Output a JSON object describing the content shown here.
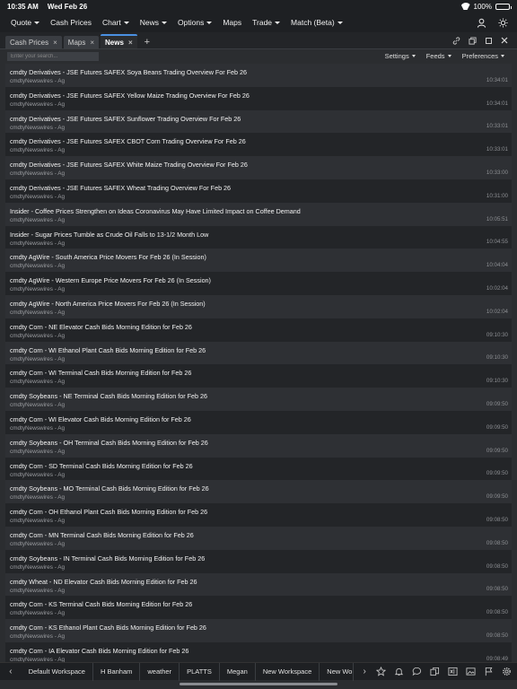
{
  "status": {
    "time": "10:35 AM",
    "date": "Wed Feb 26",
    "battery": "100%"
  },
  "menu": {
    "items": [
      {
        "label": "Quote",
        "caret": true
      },
      {
        "label": "Cash Prices",
        "caret": false
      },
      {
        "label": "Chart",
        "caret": true
      },
      {
        "label": "News",
        "caret": true
      },
      {
        "label": "Options",
        "caret": true
      },
      {
        "label": "Maps",
        "caret": false
      },
      {
        "label": "Trade",
        "caret": true
      },
      {
        "label": "Match (Beta)",
        "caret": true
      }
    ]
  },
  "tabs": [
    {
      "label": "Cash Prices",
      "active": false
    },
    {
      "label": "Maps",
      "active": false
    },
    {
      "label": "News",
      "active": true
    }
  ],
  "tab_add": "+",
  "tab_close": "×",
  "toolbar": {
    "search_placeholder": "Enter your search...",
    "settings": "Settings",
    "feeds": "Feeds",
    "preferences": "Preferences"
  },
  "news": [
    {
      "title": "cmdty Derivatives - JSE Futures SAFEX Soya Beans Trading Overview For Feb 26",
      "source": "cmdtyNewswires - Ag",
      "time": "10:34:01"
    },
    {
      "title": "cmdty Derivatives - JSE Futures SAFEX Yellow Maize Trading Overview For Feb 26",
      "source": "cmdtyNewswires - Ag",
      "time": "10:34:01"
    },
    {
      "title": "cmdty Derivatives - JSE Futures SAFEX Sunflower Trading Overview For Feb 26",
      "source": "cmdtyNewswires - Ag",
      "time": "10:33:01"
    },
    {
      "title": "cmdty Derivatives - JSE Futures SAFEX CBOT Corn Trading Overview For Feb 26",
      "source": "cmdtyNewswires - Ag",
      "time": "10:33:01"
    },
    {
      "title": "cmdty Derivatives - JSE Futures SAFEX White Maize Trading Overview For Feb 26",
      "source": "cmdtyNewswires - Ag",
      "time": "10:33:00"
    },
    {
      "title": "cmdty Derivatives - JSE Futures SAFEX Wheat Trading Overview For Feb 26",
      "source": "cmdtyNewswires - Ag",
      "time": "10:31:00"
    },
    {
      "title": "Insider - Coffee Prices Strengthen on Ideas Coronavirus May Have Limited Impact on Coffee Demand",
      "source": "cmdtyNewswires - Ag",
      "time": "10:05:51"
    },
    {
      "title": "Insider - Sugar Prices Tumble as Crude Oil Falls to 13-1/2 Month Low",
      "source": "cmdtyNewswires - Ag",
      "time": "10:04:55"
    },
    {
      "title": "cmdty AgWire - South America Price Movers For Feb 26 (In Session)",
      "source": "cmdtyNewswires - Ag",
      "time": "10:04:04"
    },
    {
      "title": "cmdty AgWire - Western Europe Price Movers For Feb 26 (In Session)",
      "source": "cmdtyNewswires - Ag",
      "time": "10:02:04"
    },
    {
      "title": "cmdty AgWire - North America Price Movers For Feb 26 (In Session)",
      "source": "cmdtyNewswires - Ag",
      "time": "10:02:04"
    },
    {
      "title": "cmdty Corn - NE Elevator Cash Bids Morning Edition for Feb 26",
      "source": "cmdtyNewswires - Ag",
      "time": "09:10:30"
    },
    {
      "title": "cmdty Corn - WI Ethanol Plant Cash Bids Morning Edition for Feb 26",
      "source": "cmdtyNewswires - Ag",
      "time": "09:10:30"
    },
    {
      "title": "cmdty Corn - WI Terminal Cash Bids Morning Edition for Feb 26",
      "source": "cmdtyNewswires - Ag",
      "time": "09:10:30"
    },
    {
      "title": "cmdty Soybeans - NE Terminal Cash Bids Morning Edition for Feb 26",
      "source": "cmdtyNewswires - Ag",
      "time": "09:09:50"
    },
    {
      "title": "cmdty Corn - WI Elevator Cash Bids Morning Edition for Feb 26",
      "source": "cmdtyNewswires - Ag",
      "time": "09:09:50"
    },
    {
      "title": "cmdty Soybeans - OH Terminal Cash Bids Morning Edition for Feb 26",
      "source": "cmdtyNewswires - Ag",
      "time": "09:09:50"
    },
    {
      "title": "cmdty Corn - SD Terminal Cash Bids Morning Edition for Feb 26",
      "source": "cmdtyNewswires - Ag",
      "time": "09:09:50"
    },
    {
      "title": "cmdty Soybeans - MO Terminal Cash Bids Morning Edition for Feb 26",
      "source": "cmdtyNewswires - Ag",
      "time": "09:09:50"
    },
    {
      "title": "cmdty Corn - OH Ethanol Plant Cash Bids Morning Edition for Feb 26",
      "source": "cmdtyNewswires - Ag",
      "time": "09:08:50"
    },
    {
      "title": "cmdty Corn - MN Terminal Cash Bids Morning Edition for Feb 26",
      "source": "cmdtyNewswires - Ag",
      "time": "09:08:50"
    },
    {
      "title": "cmdty Soybeans - IN Terminal Cash Bids Morning Edition for Feb 26",
      "source": "cmdtyNewswires - Ag",
      "time": "09:08:50"
    },
    {
      "title": "cmdty Wheat - ND Elevator Cash Bids Morning Edition for Feb 26",
      "source": "cmdtyNewswires - Ag",
      "time": "09:08:50"
    },
    {
      "title": "cmdty Corn - KS Terminal Cash Bids Morning Edition for Feb 26",
      "source": "cmdtyNewswires - Ag",
      "time": "09:08:50"
    },
    {
      "title": "cmdty Corn - KS Ethanol Plant Cash Bids Morning Edition for Feb 26",
      "source": "cmdtyNewswires - Ag",
      "time": "09:08:50"
    },
    {
      "title": "cmdty Corn - IA Elevator Cash Bids Morning Edition for Feb 26",
      "source": "cmdtyNewswires - Ag",
      "time": "09:08:49"
    }
  ],
  "workspaces": [
    "Default Workspace",
    "H Banham",
    "weather",
    "PLATTS",
    "Megan",
    "New Workspace",
    "New Wor"
  ],
  "colors": {
    "accent": "#4a90e2",
    "background": "#2b2d30",
    "bar": "#1e2023"
  }
}
